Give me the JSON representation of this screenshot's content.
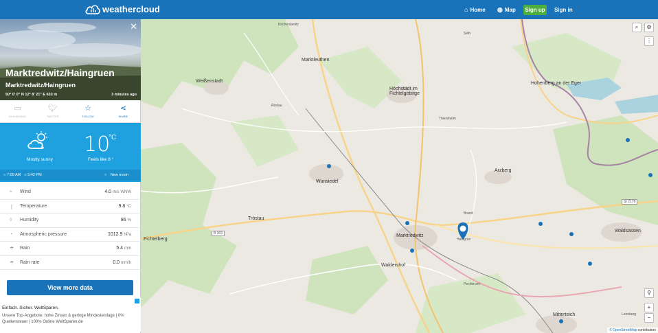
{
  "header": {
    "logo_text": "weathercloud",
    "nav_home": "Home",
    "nav_map": "Map",
    "signup": "Sign up",
    "signin": "Sign in"
  },
  "station": {
    "title": "Marktredwitz/Haingruen",
    "subtitle": "Marktredwitz/Haingruen",
    "coords": "50° 0' 0\" N   12° 8' 21\" E   633 m",
    "updated": "3 minutes ago"
  },
  "social": [
    {
      "icon": "dashboard-icon",
      "label": "DASHBOARD"
    },
    {
      "icon": "twitter-icon",
      "label": "TWITTER"
    },
    {
      "icon": "star-icon",
      "label": "FOLLOW"
    },
    {
      "icon": "share-icon",
      "label": "SHARE"
    }
  ],
  "weather": {
    "condition": "Mostly sunny",
    "temp": "10",
    "unit": "°C",
    "feels": "Feels like 8 °",
    "sunrise": "7:09 AM",
    "sunset": "5:42 PM",
    "moon": "New moon"
  },
  "rows": [
    {
      "icon": "wind-icon",
      "label": "Wind",
      "value": "4.0",
      "unit": "m/s WNW"
    },
    {
      "icon": "thermometer-icon",
      "label": "Temperature",
      "value": "9.8",
      "unit": "°C"
    },
    {
      "icon": "humidity-icon",
      "label": "Humidity",
      "value": "86",
      "unit": "%"
    },
    {
      "icon": "pressure-icon",
      "label": "Atmospheric pressure",
      "value": "1012.9",
      "unit": "hPa"
    },
    {
      "icon": "rain-icon",
      "label": "Rain",
      "value": "5.4",
      "unit": "mm"
    },
    {
      "icon": "rain-rate-icon",
      "label": "Rain rate",
      "value": "0.0",
      "unit": "mm/h"
    }
  ],
  "view_more": "View more data",
  "ad": {
    "title": "Einfach. Sicher. WeltSparen.",
    "text": "Unsere Top-Angebote: hohe Zinsen & geringe Mindesteinlage | 0% Quellensteuer | 100% Online WeltSparen.de"
  },
  "map": {
    "attribution_link": "© OpenStreetMap",
    "attribution_rest": " contributors",
    "labels": {
      "hohenberg": "Hohenberg an der Eger",
      "marktleuthen": "Marktleuthen",
      "hochstadt": "Höchstädt im Fichtelgebirge",
      "weissenstadt": "Weißenstadt",
      "rosslau": "Röslau",
      "wunsiedel": "Wunsiedel",
      "marktredwitz": "Marktredwitz",
      "troestau": "Tröstau",
      "fichtelberg": "Fichtelberg",
      "waldershof": "Waldershof",
      "arzberg": "Arzberg",
      "waldsassen": "Waldsassen",
      "mitterteich": "Mitterteich",
      "thiersheim": "Thiersheim",
      "kirchenlamitz": "Kirchenlamitz",
      "selb": "Selb",
      "pechbrunn": "Pechbrunn",
      "brand": "Brand",
      "haingruen": "Haingrün",
      "leonberg": "Leonberg",
      "b303": "B 303",
      "st2178": "St 2178"
    }
  }
}
